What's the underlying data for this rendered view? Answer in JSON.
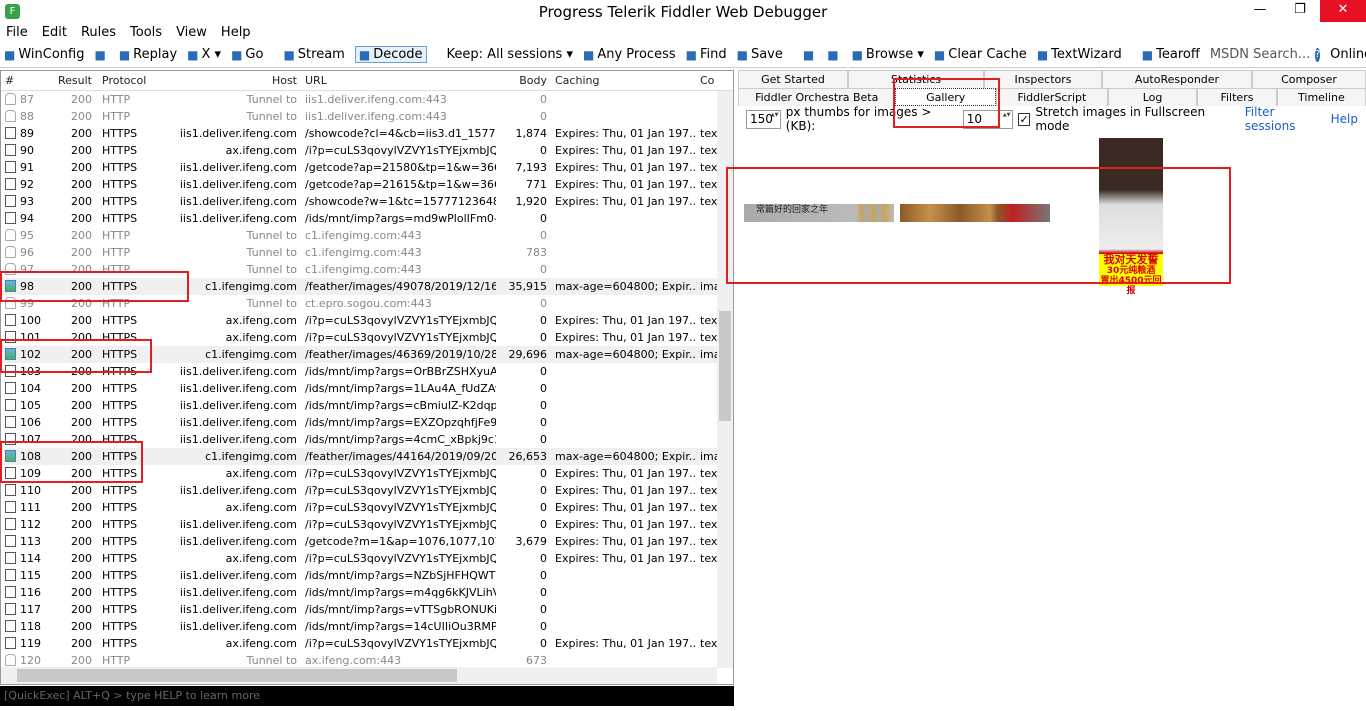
{
  "window": {
    "title": "Progress Telerik Fiddler Web Debugger",
    "icon_letter": "F"
  },
  "menu": [
    "File",
    "Edit",
    "Rules",
    "Tools",
    "View",
    "Help"
  ],
  "toolbar": [
    {
      "icon": "windows-icon",
      "label": "WinConfig"
    },
    {
      "icon": "chat-icon",
      "label": ""
    },
    {
      "icon": "replay-icon",
      "label": "Replay"
    },
    {
      "icon": "remove-icon",
      "label": "X ▾"
    },
    {
      "icon": "go-icon",
      "label": "Go"
    },
    {
      "icon": "stream-icon",
      "label": "Stream"
    },
    {
      "icon": "decode-icon",
      "label": "Decode",
      "active": true
    },
    {
      "icon": "",
      "label": "Keep: All sessions ▾"
    },
    {
      "icon": "crosshair-icon",
      "label": "Any Process"
    },
    {
      "icon": "binoculars-icon",
      "label": "Find"
    },
    {
      "icon": "save-icon",
      "label": "Save"
    },
    {
      "icon": "screenshot-icon",
      "label": ""
    },
    {
      "icon": "timer-icon",
      "label": ""
    },
    {
      "icon": "ie-icon",
      "label": "Browse ▾"
    },
    {
      "icon": "clear-cache-icon",
      "label": "Clear Cache"
    },
    {
      "icon": "textwizard-icon",
      "label": "TextWizard"
    },
    {
      "icon": "tearoff-icon",
      "label": "Tearoff"
    }
  ],
  "msdn_placeholder": "MSDN Search...",
  "online_label": "Online",
  "columns": [
    "#",
    "Result",
    "Protocol",
    "Host",
    "URL",
    "Body",
    "Caching",
    "Co"
  ],
  "sessions": [
    [
      "87",
      "200",
      "HTTP",
      "Tunnel to",
      "iis1.deliver.ifeng.com:443",
      "0",
      "",
      "",
      "tunnel"
    ],
    [
      "88",
      "200",
      "HTTP",
      "Tunnel to",
      "iis1.deliver.ifeng.com:443",
      "0",
      "",
      "",
      "tunnel"
    ],
    [
      "89",
      "200",
      "HTTPS",
      "iis1.deliver.ifeng.com",
      "/showcode?cl=4&cb=iis3.d1_15777...",
      "1,874",
      "Expires: Thu, 01 Jan 197...",
      "tex",
      "doc"
    ],
    [
      "90",
      "200",
      "HTTPS",
      "ax.ifeng.com",
      "/i?p=cuLS3qovylVZVY1sTYEjxmbJQZ...",
      "0",
      "Expires: Thu, 01 Jan 197...",
      "tex",
      "doc"
    ],
    [
      "91",
      "200",
      "HTTPS",
      "iis1.deliver.ifeng.com",
      "/getcode?ap=21580&tp=1&w=366...",
      "7,193",
      "Expires: Thu, 01 Jan 197...",
      "tex",
      "doc"
    ],
    [
      "92",
      "200",
      "HTTPS",
      "iis1.deliver.ifeng.com",
      "/getcode?ap=21615&tp=1&w=366...",
      "771",
      "Expires: Thu, 01 Jan 197...",
      "tex",
      "doc"
    ],
    [
      "93",
      "200",
      "HTTPS",
      "iis1.deliver.ifeng.com",
      "/showcode?w=1&tc=157771236484...",
      "1,920",
      "Expires: Thu, 01 Jan 197...",
      "tex",
      "doc"
    ],
    [
      "94",
      "200",
      "HTTPS",
      "iis1.deliver.ifeng.com",
      "/ids/mnt/imp?args=md9wPlolIFm0-5...",
      "0",
      "",
      "",
      "doc"
    ],
    [
      "95",
      "200",
      "HTTP",
      "Tunnel to",
      "c1.ifengimg.com:443",
      "0",
      "",
      "",
      "tunnel"
    ],
    [
      "96",
      "200",
      "HTTP",
      "Tunnel to",
      "c1.ifengimg.com:443",
      "783",
      "",
      "",
      "tunnel"
    ],
    [
      "97",
      "200",
      "HTTP",
      "Tunnel to",
      "c1.ifengimg.com:443",
      "0",
      "",
      "",
      "tunnel"
    ],
    [
      "98",
      "200",
      "HTTPS",
      "c1.ifengimg.com",
      "/feather/images/49078/2019/12/16/...",
      "35,915",
      "max-age=604800; Expir...",
      "ima",
      "img"
    ],
    [
      "99",
      "200",
      "HTTP",
      "Tunnel to",
      "ct.epro.sogou.com:443",
      "0",
      "",
      "",
      "tunnel"
    ],
    [
      "100",
      "200",
      "HTTPS",
      "ax.ifeng.com",
      "/i?p=cuLS3qovylVZVY1sTYEjxmbJQZ...",
      "0",
      "Expires: Thu, 01 Jan 197...",
      "tex",
      "doc"
    ],
    [
      "101",
      "200",
      "HTTPS",
      "ax.ifeng.com",
      "/i?p=cuLS3qovylVZVY1sTYEjxmbJQZ...",
      "0",
      "Expires: Thu, 01 Jan 197...",
      "tex",
      "doc"
    ],
    [
      "102",
      "200",
      "HTTPS",
      "c1.ifengimg.com",
      "/feather/images/46369/2019/10/28/...",
      "29,696",
      "max-age=604800; Expir...",
      "ima",
      "img"
    ],
    [
      "103",
      "200",
      "HTTPS",
      "iis1.deliver.ifeng.com",
      "/ids/mnt/imp?args=OrBBrZSHXyuArp...",
      "0",
      "",
      "",
      "doc"
    ],
    [
      "104",
      "200",
      "HTTPS",
      "iis1.deliver.ifeng.com",
      "/ids/mnt/imp?args=1LAu4A_fUdZAw...",
      "0",
      "",
      "",
      "doc"
    ],
    [
      "105",
      "200",
      "HTTPS",
      "iis1.deliver.ifeng.com",
      "/ids/mnt/imp?args=cBmiuIZ-K2dqph...",
      "0",
      "",
      "",
      "doc"
    ],
    [
      "106",
      "200",
      "HTTPS",
      "iis1.deliver.ifeng.com",
      "/ids/mnt/imp?args=EXZOpzqhfjFe9E...",
      "0",
      "",
      "",
      "doc"
    ],
    [
      "107",
      "200",
      "HTTPS",
      "iis1.deliver.ifeng.com",
      "/ids/mnt/imp?args=4cmC_xBpkj9c1R...",
      "0",
      "",
      "",
      "doc"
    ],
    [
      "108",
      "200",
      "HTTPS",
      "c1.ifengimg.com",
      "/feather/images/44164/2019/09/20/...",
      "26,653",
      "max-age=604800; Expir...",
      "ima",
      "img"
    ],
    [
      "109",
      "200",
      "HTTPS",
      "ax.ifeng.com",
      "/i?p=cuLS3qovylVZVY1sTYEjxmbJQZ...",
      "0",
      "Expires: Thu, 01 Jan 197...",
      "tex",
      "doc"
    ],
    [
      "110",
      "200",
      "HTTPS",
      "iis1.deliver.ifeng.com",
      "/i?p=cuLS3qovylVZVY1sTYEjxmbJQZ...",
      "0",
      "Expires: Thu, 01 Jan 197...",
      "tex",
      "doc"
    ],
    [
      "111",
      "200",
      "HTTPS",
      "ax.ifeng.com",
      "/i?p=cuLS3qovylVZVY1sTYEjxmbJQZ...",
      "0",
      "Expires: Thu, 01 Jan 197...",
      "tex",
      "doc"
    ],
    [
      "112",
      "200",
      "HTTPS",
      "iis1.deliver.ifeng.com",
      "/i?p=cuLS3qovylVZVY1sTYEjxmbJQZ...",
      "0",
      "Expires: Thu, 01 Jan 197...",
      "tex",
      "doc"
    ],
    [
      "113",
      "200",
      "HTTPS",
      "iis1.deliver.ifeng.com",
      "/getcode?m=1&ap=1076,1077,107...",
      "3,679",
      "Expires: Thu, 01 Jan 197...",
      "tex",
      "doc"
    ],
    [
      "114",
      "200",
      "HTTPS",
      "ax.ifeng.com",
      "/i?p=cuLS3qovylVZVY1sTYEjxmbJQZ...",
      "0",
      "Expires: Thu, 01 Jan 197...",
      "tex",
      "doc"
    ],
    [
      "115",
      "200",
      "HTTPS",
      "iis1.deliver.ifeng.com",
      "/ids/mnt/imp?args=NZbSjHFHQWTO...",
      "0",
      "",
      "",
      "doc"
    ],
    [
      "116",
      "200",
      "HTTPS",
      "iis1.deliver.ifeng.com",
      "/ids/mnt/imp?args=m4qg6kKJVLihVZ...",
      "0",
      "",
      "",
      "doc"
    ],
    [
      "117",
      "200",
      "HTTPS",
      "iis1.deliver.ifeng.com",
      "/ids/mnt/imp?args=vTTSgbRONUKi-...",
      "0",
      "",
      "",
      "doc"
    ],
    [
      "118",
      "200",
      "HTTPS",
      "iis1.deliver.ifeng.com",
      "/ids/mnt/imp?args=14cUIIiOu3RMPE...",
      "0",
      "",
      "",
      "doc"
    ],
    [
      "119",
      "200",
      "HTTPS",
      "ax.ifeng.com",
      "/i?p=cuLS3qovylVZVY1sTYEjxmbJQZ...",
      "0",
      "Expires: Thu, 01 Jan 197...",
      "tex",
      "doc"
    ],
    [
      "120",
      "200",
      "HTTP",
      "Tunnel to",
      "ax.ifeng.com:443",
      "673",
      "",
      "",
      "tunnel"
    ]
  ],
  "quickexec": "[QuickExec] ALT+Q > type HELP to learn more",
  "tabs_row1": [
    "Get Started",
    "Statistics",
    "Inspectors",
    "AutoResponder",
    "Composer"
  ],
  "tabs_row2": [
    "Fiddler Orchestra Beta",
    "Gallery",
    "FiddlerScript",
    "Log",
    "Filters",
    "Timeline"
  ],
  "selected_tab": "Gallery",
  "gallery": {
    "thumb_size": "150",
    "thumb_label": "px thumbs for images > (KB):",
    "min_kb": "10",
    "stretch_checked": true,
    "stretch_label": "Stretch images in Fullscreen mode",
    "filter_link": "Filter sessions",
    "help_link": "Help",
    "banner1_text": "常篇好的回家之年",
    "ad_text": [
      "我对天发誓",
      "30元纯粮酒",
      "胃出4500元回报"
    ]
  },
  "colors": {
    "annotation": "#e02020",
    "accent": "#1a5fc8"
  }
}
